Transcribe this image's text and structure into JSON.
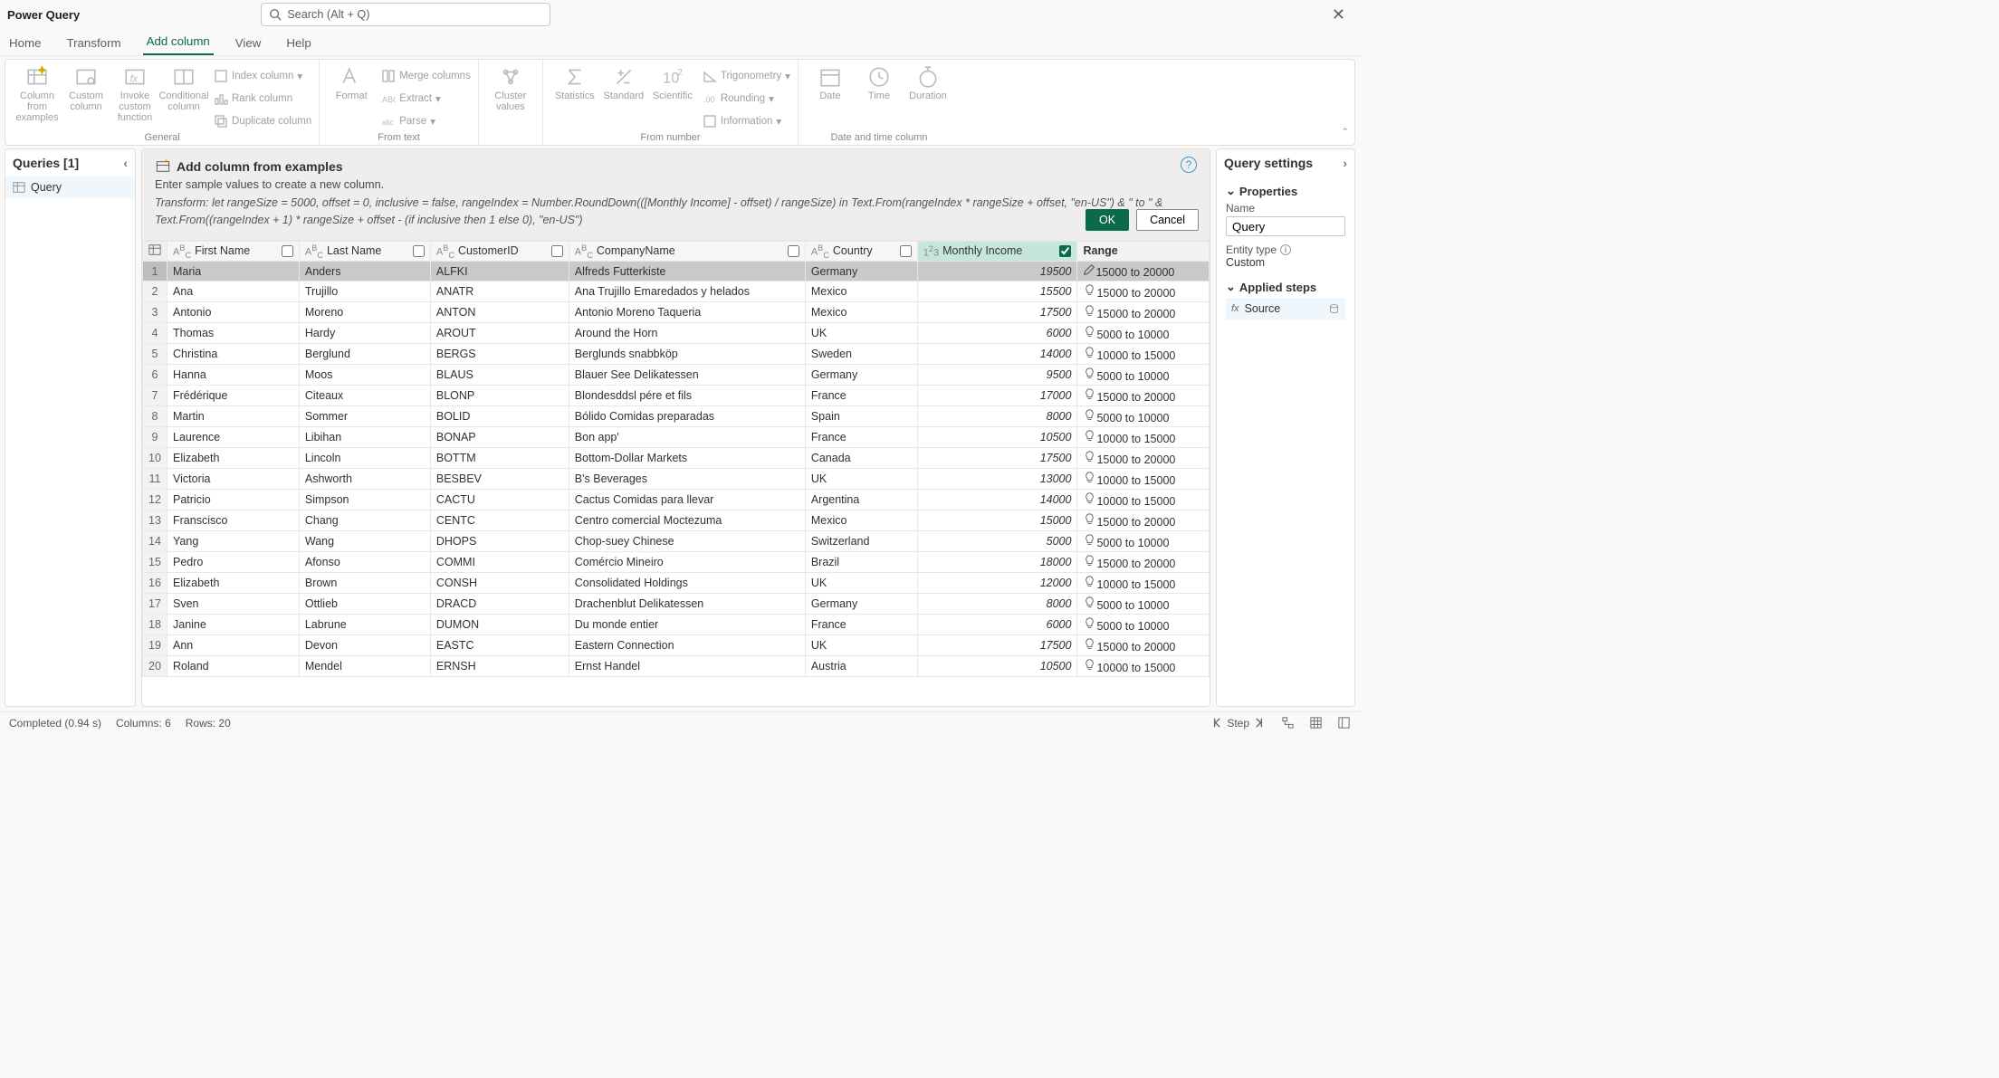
{
  "title": "Power Query",
  "search_placeholder": "Search (Alt + Q)",
  "tabs": {
    "home": "Home",
    "transform": "Transform",
    "addcolumn": "Add column",
    "view": "View",
    "help": "Help"
  },
  "ribbon": {
    "general": {
      "label": "General",
      "columnFromExamples": "Column from examples",
      "customColumn": "Custom column",
      "invokeCustom": "Invoke custom function",
      "conditional": "Conditional column",
      "indexColumn": "Index column",
      "rankColumn": "Rank column",
      "duplicateColumn": "Duplicate column"
    },
    "fromtext": {
      "label": "From text",
      "format": "Format",
      "mergeColumns": "Merge columns",
      "extract": "Extract",
      "parse": "Parse"
    },
    "cluster": {
      "label": "",
      "clusterValues": "Cluster values"
    },
    "fromnumber": {
      "label": "From number",
      "statistics": "Statistics",
      "standard": "Standard",
      "scientific": "Scientific",
      "trigonometry": "Trigonometry",
      "rounding": "Rounding",
      "information": "Information"
    },
    "datetime": {
      "label": "Date and time column",
      "date": "Date",
      "time": "Time",
      "duration": "Duration"
    }
  },
  "queriesHeader": "Queries [1]",
  "queryName": "Query",
  "banner": {
    "title": "Add column from examples",
    "subtitle": "Enter sample values to create a new column.",
    "formula": "Transform: let rangeSize = 5000, offset = 0, inclusive = false, rangeIndex = Number.RoundDown(([Monthly Income] - offset) / rangeSize) in Text.From(rangeIndex * rangeSize + offset, \"en-US\") & \" to \" & Text.From((rangeIndex + 1) * rangeSize + offset - (if inclusive then 1 else 0), \"en-US\")",
    "ok": "OK",
    "cancel": "Cancel"
  },
  "columns": {
    "firstName": "First Name",
    "lastName": "Last Name",
    "customerId": "CustomerID",
    "companyName": "CompanyName",
    "country": "Country",
    "monthlyIncome": "Monthly Income",
    "range": "Range"
  },
  "rows": [
    {
      "n": "1",
      "first": "Maria",
      "last": "Anders",
      "cid": "ALFKI",
      "company": "Alfreds Futterkiste",
      "country": "Germany",
      "income": "19500",
      "range": "15000 to 20000"
    },
    {
      "n": "2",
      "first": "Ana",
      "last": "Trujillo",
      "cid": "ANATR",
      "company": "Ana Trujillo Emaredados y helados",
      "country": "Mexico",
      "income": "15500",
      "range": "15000 to 20000"
    },
    {
      "n": "3",
      "first": "Antonio",
      "last": "Moreno",
      "cid": "ANTON",
      "company": "Antonio Moreno Taqueria",
      "country": "Mexico",
      "income": "17500",
      "range": "15000 to 20000"
    },
    {
      "n": "4",
      "first": "Thomas",
      "last": "Hardy",
      "cid": "AROUT",
      "company": "Around the Horn",
      "country": "UK",
      "income": "6000",
      "range": "5000 to 10000"
    },
    {
      "n": "5",
      "first": "Christina",
      "last": "Berglund",
      "cid": "BERGS",
      "company": "Berglunds snabbköp",
      "country": "Sweden",
      "income": "14000",
      "range": "10000 to 15000"
    },
    {
      "n": "6",
      "first": "Hanna",
      "last": "Moos",
      "cid": "BLAUS",
      "company": "Blauer See Delikatessen",
      "country": "Germany",
      "income": "9500",
      "range": "5000 to 10000"
    },
    {
      "n": "7",
      "first": "Frédérique",
      "last": "Citeaux",
      "cid": "BLONP",
      "company": "Blondesddsl pére et fils",
      "country": "France",
      "income": "17000",
      "range": "15000 to 20000"
    },
    {
      "n": "8",
      "first": "Martin",
      "last": "Sommer",
      "cid": "BOLID",
      "company": "Bólido Comidas preparadas",
      "country": "Spain",
      "income": "8000",
      "range": "5000 to 10000"
    },
    {
      "n": "9",
      "first": "Laurence",
      "last": "Libihan",
      "cid": "BONAP",
      "company": "Bon app'",
      "country": "France",
      "income": "10500",
      "range": "10000 to 15000"
    },
    {
      "n": "10",
      "first": "Elizabeth",
      "last": "Lincoln",
      "cid": "BOTTM",
      "company": "Bottom-Dollar Markets",
      "country": "Canada",
      "income": "17500",
      "range": "15000 to 20000"
    },
    {
      "n": "11",
      "first": "Victoria",
      "last": "Ashworth",
      "cid": "BESBEV",
      "company": "B's Beverages",
      "country": "UK",
      "income": "13000",
      "range": "10000 to 15000"
    },
    {
      "n": "12",
      "first": "Patricio",
      "last": "Simpson",
      "cid": "CACTU",
      "company": "Cactus Comidas para llevar",
      "country": "Argentina",
      "income": "14000",
      "range": "10000 to 15000"
    },
    {
      "n": "13",
      "first": "Franscisco",
      "last": "Chang",
      "cid": "CENTC",
      "company": "Centro comercial Moctezuma",
      "country": "Mexico",
      "income": "15000",
      "range": "15000 to 20000"
    },
    {
      "n": "14",
      "first": "Yang",
      "last": "Wang",
      "cid": "DHOPS",
      "company": "Chop-suey Chinese",
      "country": "Switzerland",
      "income": "5000",
      "range": "5000 to 10000"
    },
    {
      "n": "15",
      "first": "Pedro",
      "last": "Afonso",
      "cid": "COMMI",
      "company": "Comércio Mineiro",
      "country": "Brazil",
      "income": "18000",
      "range": "15000 to 20000"
    },
    {
      "n": "16",
      "first": "Elizabeth",
      "last": "Brown",
      "cid": "CONSH",
      "company": "Consolidated Holdings",
      "country": "UK",
      "income": "12000",
      "range": "10000 to 15000"
    },
    {
      "n": "17",
      "first": "Sven",
      "last": "Ottlieb",
      "cid": "DRACD",
      "company": "Drachenblut Delikatessen",
      "country": "Germany",
      "income": "8000",
      "range": "5000 to 10000"
    },
    {
      "n": "18",
      "first": "Janine",
      "last": "Labrune",
      "cid": "DUMON",
      "company": "Du monde entier",
      "country": "France",
      "income": "6000",
      "range": "5000 to 10000"
    },
    {
      "n": "19",
      "first": "Ann",
      "last": "Devon",
      "cid": "EASTC",
      "company": "Eastern Connection",
      "country": "UK",
      "income": "17500",
      "range": "15000 to 20000"
    },
    {
      "n": "20",
      "first": "Roland",
      "last": "Mendel",
      "cid": "ERNSH",
      "company": "Ernst Handel",
      "country": "Austria",
      "income": "10500",
      "range": "10000 to 15000"
    }
  ],
  "settings": {
    "title": "Query settings",
    "properties": "Properties",
    "nameLabel": "Name",
    "nameValue": "Query",
    "entityTypeLabel": "Entity type",
    "entityTypeValue": "Custom",
    "appliedSteps": "Applied steps",
    "sourceStep": "Source"
  },
  "status": {
    "completed": "Completed (0.94 s)",
    "columns": "Columns: 6",
    "rows": "Rows: 20",
    "step": "Step"
  }
}
